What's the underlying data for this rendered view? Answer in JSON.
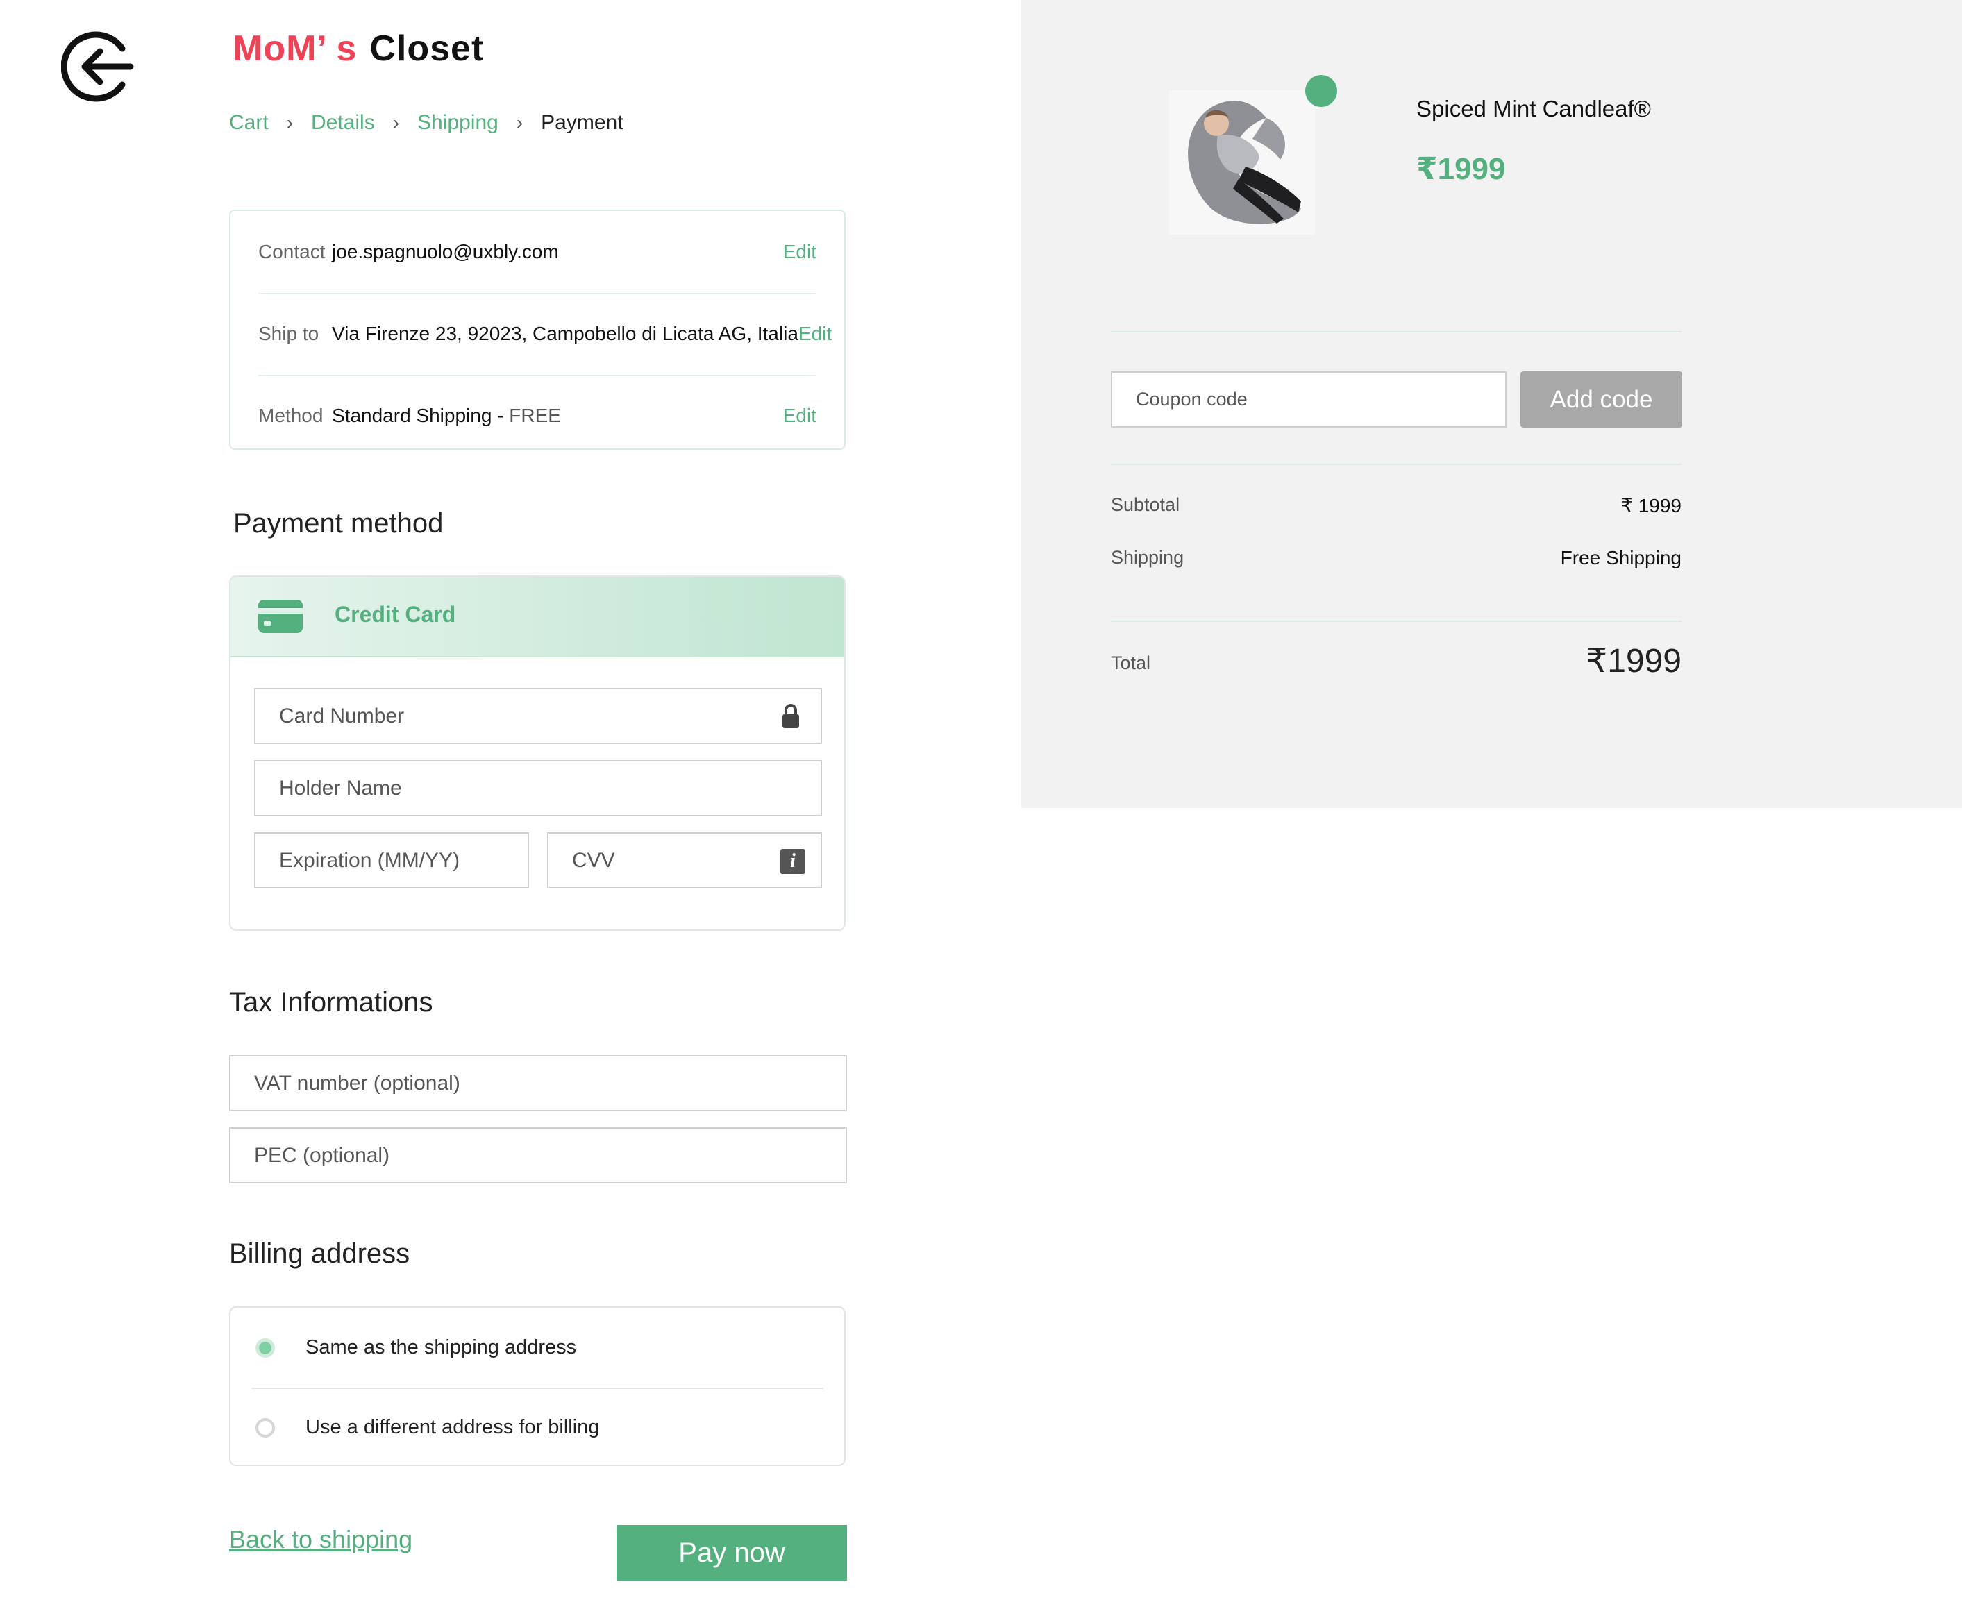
{
  "brand": {
    "part1": "MoM’ s",
    "part2": "Closet"
  },
  "breadcrumb": {
    "items": [
      "Cart",
      "Details",
      "Shipping",
      "Payment"
    ],
    "separator": "›"
  },
  "review": {
    "contact": {
      "label": "Contact",
      "value": "joe.spagnuolo@uxbly.com",
      "edit": "Edit"
    },
    "ship_to": {
      "label": "Ship to",
      "value": "Via Firenze 23, 92023, Campobello di  Licata AG, Italia",
      "edit": "Edit"
    },
    "method": {
      "label": "Method",
      "value": "Standard Shipping - ",
      "value_suffix": "FREE",
      "edit": "Edit"
    }
  },
  "payment": {
    "title": "Payment method",
    "option_label": "Credit Card",
    "card_number_placeholder": "Card Number",
    "holder_placeholder": "Holder Name",
    "expiration_placeholder": "Expiration (MM/YY)",
    "cvv_placeholder": "CVV",
    "cvv_info_glyph": "i"
  },
  "tax": {
    "title": "Tax Informations",
    "vat_placeholder": "VAT number  (optional)",
    "pec_placeholder": "PEC (optional)"
  },
  "billing": {
    "title": "Billing address",
    "options": [
      {
        "label": "Same as the shipping address",
        "selected": true
      },
      {
        "label": "Use a different address for billing",
        "selected": false
      }
    ]
  },
  "actions": {
    "back": "Back to shipping",
    "pay": "Pay now"
  },
  "order": {
    "product_name": "Spiced Mint Candleaf®",
    "product_price": "₹1999",
    "coupon_placeholder": "Coupon code",
    "coupon_button": "Add code",
    "subtotal_label": "Subtotal",
    "subtotal_value": "₹ 1999",
    "shipping_label": "Shipping",
    "shipping_value": "Free Shipping",
    "total_label": "Total",
    "total_value": "₹1999"
  },
  "colors": {
    "accent": "#55b07f",
    "brand_red": "#ee4257",
    "panel_bg": "#f2f2f2",
    "disabled_button": "#a8a8a8"
  },
  "icons": {
    "back": "arrow-left-circle-icon",
    "card": "credit-card-icon",
    "lock": "lock-icon",
    "info": "info-icon"
  }
}
